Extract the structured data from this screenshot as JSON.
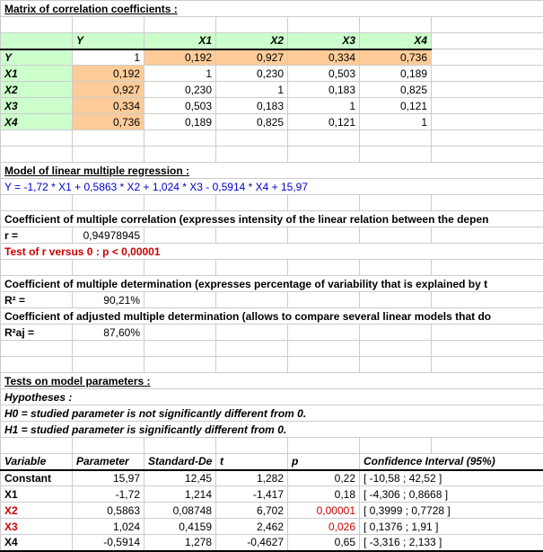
{
  "titles": {
    "matrix": "Matrix of correlation coefficients :",
    "model": "Model of linear multiple regression :",
    "coef_r": "Coefficient of multiple correlation (expresses intensity of the linear relation between the depen",
    "coef_r2": "Coefficient of multiple determination (expresses percentage of variability that is explained by t",
    "coef_r2aj": "Coefficient of adjusted multiple determination (allows to compare several linear models that do",
    "tests": "Tests on model parameters :",
    "hypos": "Hypotheses :",
    "h0": "H0 = studied parameter is not significantly different from 0.",
    "h1": "H1 = studied parameter is significantly different from 0."
  },
  "corr": {
    "headers": [
      "Y",
      "X1",
      "X2",
      "X3",
      "X4"
    ],
    "rows": [
      {
        "label": "Y",
        "vals": [
          "1",
          "0,192",
          "0,927",
          "0,334",
          "0,736"
        ]
      },
      {
        "label": "X1",
        "vals": [
          "0,192",
          "1",
          "0,230",
          "0,503",
          "0,189"
        ]
      },
      {
        "label": "X2",
        "vals": [
          "0,927",
          "0,230",
          "1",
          "0,183",
          "0,825"
        ]
      },
      {
        "label": "X3",
        "vals": [
          "0,334",
          "0,503",
          "0,183",
          "1",
          "0,121"
        ]
      },
      {
        "label": "X4",
        "vals": [
          "0,736",
          "0,189",
          "0,825",
          "0,121",
          "1"
        ]
      }
    ]
  },
  "equation": "Y = -1,72 * X1 + 0,5863 * X2 + 1,024 * X3 - 0,5914 * X4 + 15,97",
  "r_label": "r =",
  "r_value": "0,94978945",
  "r_test": "Test of r versus 0 : p < 0,00001",
  "r2_label": "R² =",
  "r2_value": "90,21%",
  "r2aj_label": "R²aj =",
  "r2aj_value": "87,60%",
  "params": {
    "headers": {
      "var": "Variable",
      "par": "Parameter",
      "sd": "Standard-De",
      "t": "t",
      "p": "p",
      "ci": "Confidence Interval (95%)"
    },
    "rows": [
      {
        "var": "Constant",
        "par": "15,97",
        "sd": "12,45",
        "t": "1,282",
        "p": "0,22",
        "ci": "[ -10,58 ; 42,52 ]",
        "hl": false
      },
      {
        "var": "X1",
        "par": "-1,72",
        "sd": "1,214",
        "t": "-1,417",
        "p": "0,18",
        "ci": "[ -4,306 ; 0,8668 ]",
        "hl": false
      },
      {
        "var": "X2",
        "par": "0,5863",
        "sd": "0,08748",
        "t": "6,702",
        "p": "0,00001",
        "ci": "[ 0,3999 ; 0,7728 ]",
        "hl": true
      },
      {
        "var": "X3",
        "par": "1,024",
        "sd": "0,4159",
        "t": "2,462",
        "p": "0,026",
        "ci": "[ 0,1376 ; 1,91 ]",
        "hl": true
      },
      {
        "var": "X4",
        "par": "-0,5914",
        "sd": "1,278",
        "t": "-0,4627",
        "p": "0,65",
        "ci": "[ -3,316 ; 2,133 ]",
        "hl": false
      }
    ]
  }
}
